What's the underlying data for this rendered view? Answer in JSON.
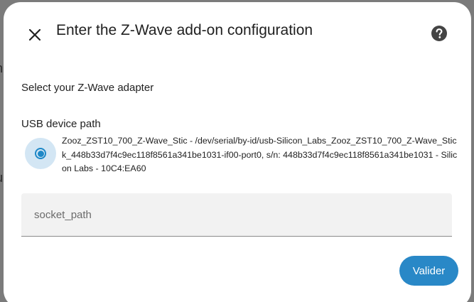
{
  "dialog": {
    "title": "Enter the Z-Wave add-on configuration",
    "close_icon": "close-icon",
    "help_icon": "help-circle-icon"
  },
  "adapter": {
    "section_label": "Select your Z-Wave adapter",
    "field_label": "USB device path",
    "option": {
      "selected": true,
      "text": "Zooz_ZST10_700_Z-Wave_Stic - /dev/serial/by-id/usb-Silicon_Labs_Zooz_ZST10_700_Z-Wave_Stick_448b33d7f4c9ec118f8561a341be1031-if00-port0, s/n: 448b33d7f4c9ec118f8561a341be1031 - Silicon Labs - 10C4:EA60"
    }
  },
  "socket_field": {
    "placeholder": "socket_path",
    "value": ""
  },
  "actions": {
    "submit_label": "Valider"
  },
  "colors": {
    "accent": "#2988c7",
    "radio_halo": "#d3e6f4",
    "scrim": "#7b7b7b"
  }
}
